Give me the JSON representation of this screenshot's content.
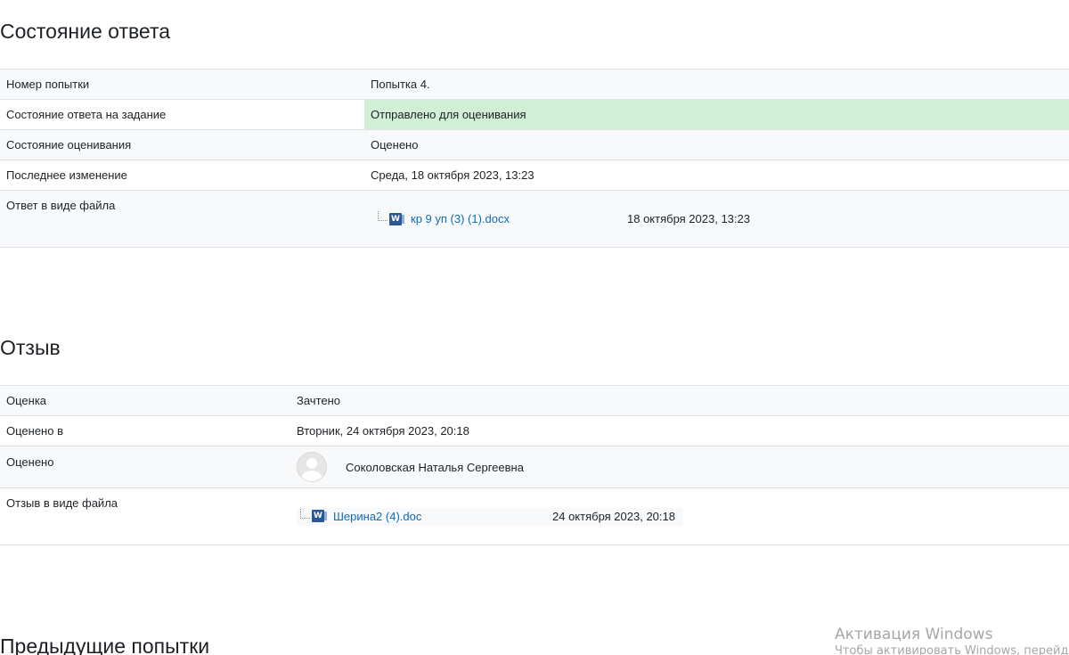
{
  "submission_status": {
    "title": "Состояние ответа",
    "rows": [
      {
        "label": "Номер попытки",
        "value": "Попытка 4."
      },
      {
        "label": "Состояние ответа на задание",
        "value": "Отправлено для оценивания"
      },
      {
        "label": "Состояние оценивания",
        "value": "Оценено"
      },
      {
        "label": "Последнее изменение",
        "value": "Среда, 18 октября 2023, 13:23"
      },
      {
        "label": "Ответ в виде файла",
        "file_name": "кр 9 уп (3) (1).docx",
        "file_date": "18 октября 2023, 13:23",
        "file_icon": "word-doc-icon"
      }
    ]
  },
  "feedback": {
    "title": "Отзыв",
    "rows": [
      {
        "label": "Оценка",
        "value": "Зачтено"
      },
      {
        "label": "Оценено в",
        "value": "Вторник, 24 октября 2023, 20:18"
      },
      {
        "label": "Оценено",
        "grader_name": "Соколовская Наталья Сергеевна",
        "avatar_icon": "default-user-avatar-icon"
      },
      {
        "label": "Отзыв в виде файла",
        "file_name": "Шерина2 (4).doc",
        "file_date": "24 октября 2023, 20:18",
        "file_icon": "word-doc-icon"
      }
    ]
  },
  "previous_attempts": {
    "title": "Предыдущие попытки"
  },
  "windows_watermark": {
    "title": "Активация Windows",
    "subtitle": "Чтобы активировать Windows, перейдите"
  },
  "colors": {
    "status_submitted_bg": "#d0efd4",
    "link": "#0f6cbf",
    "row_alt_bg": "#f8f9fa",
    "border": "#dee2e6"
  }
}
